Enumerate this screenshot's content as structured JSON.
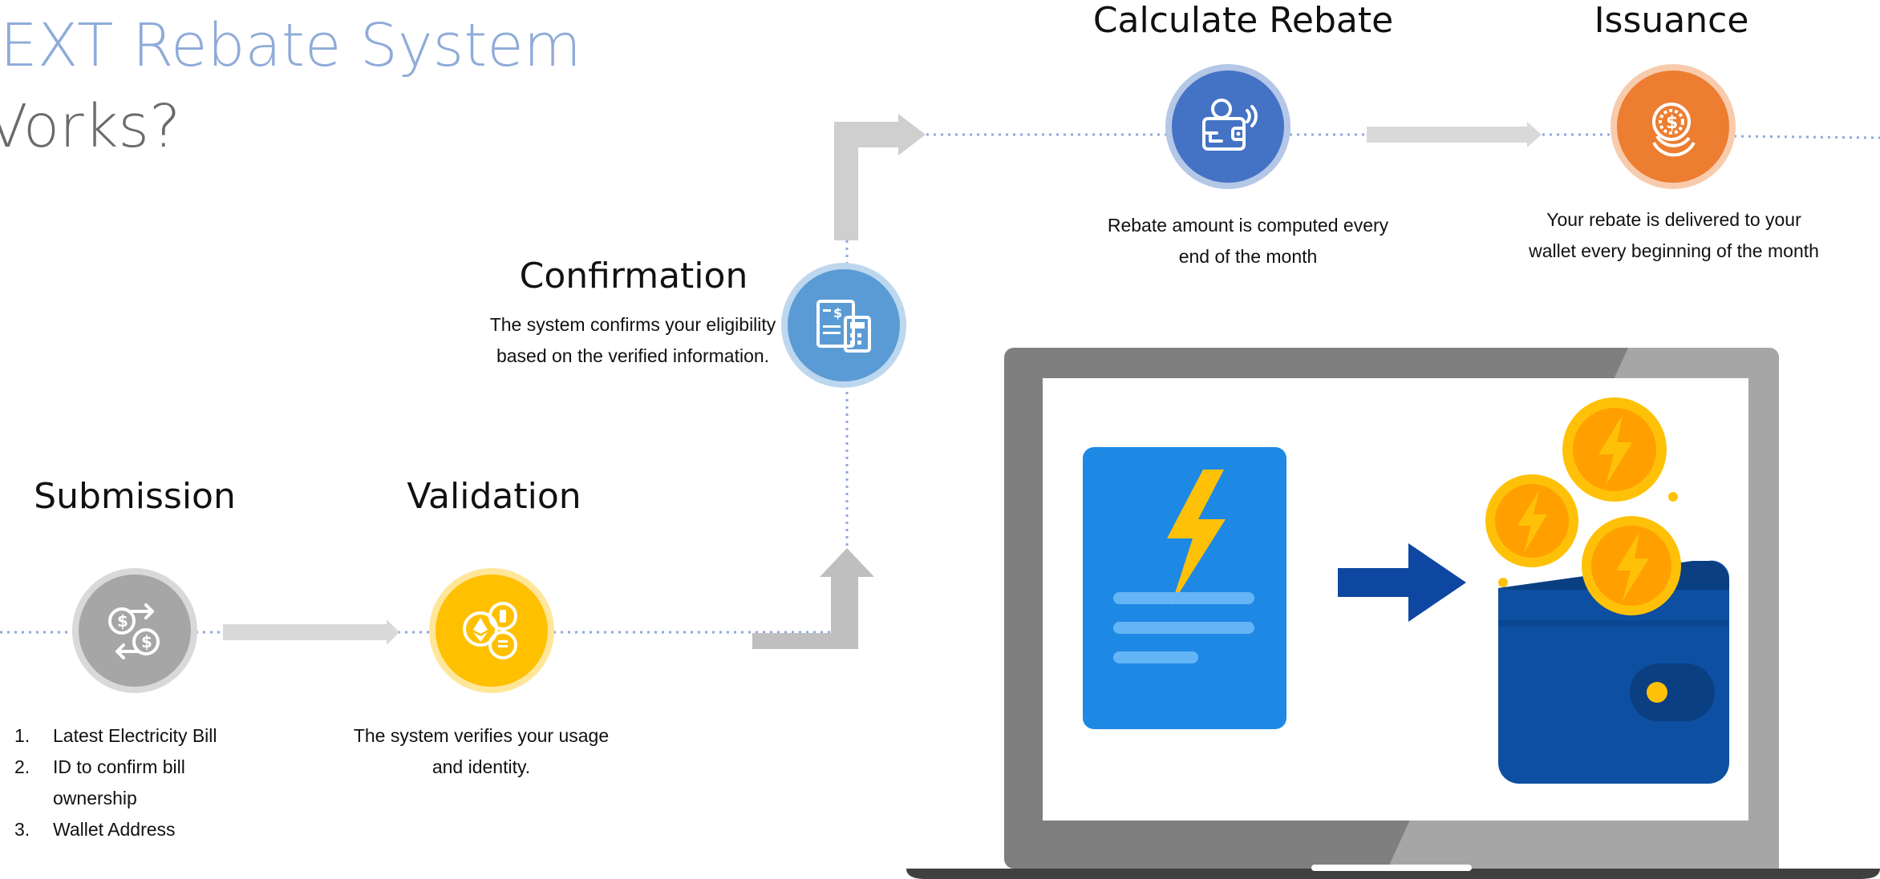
{
  "header": {
    "title_line1": "EXT Rebate System",
    "title_line2": "Vorks?"
  },
  "steps": {
    "submission": {
      "title": "Submission",
      "icon": "money-transfer-icon",
      "color": "#a6a6a6",
      "requirements": [
        {
          "num": "1.",
          "text": "Latest Electricity Bill"
        },
        {
          "num": "2.",
          "text": "ID to confirm bill ownership"
        },
        {
          "num": "3.",
          "text": "Wallet Address"
        }
      ]
    },
    "validation": {
      "title": "Validation",
      "icon": "crypto-coins-icon",
      "color": "#ffc000",
      "description": "The system verifies your usage and identity."
    },
    "confirmation": {
      "title": "Confirmation",
      "icon": "bill-calculator-icon",
      "color": "#5b9bd5",
      "description": "The system confirms your eligibility based on the verified information."
    },
    "calculate_rebate": {
      "title": "Calculate Rebate",
      "icon": "digital-wallet-icon",
      "color": "#4472c4",
      "description": "Rebate amount is computed every end of the month"
    },
    "issuance": {
      "title": "Issuance",
      "icon": "dollar-coins-icon",
      "color": "#ed7d31",
      "description": "Your rebate is delivered to your wallet every beginning of the month"
    }
  },
  "illustration": {
    "name": "laptop-bill-to-wallet-illustration",
    "colors": {
      "bill": "#1e88e5",
      "bolt": "#ffc107",
      "arrow": "#0d47a1",
      "wallet": "#0d4fa0",
      "coin": "#ffc107"
    }
  }
}
